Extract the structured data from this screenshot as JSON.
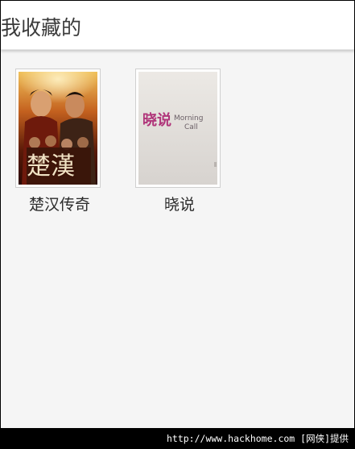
{
  "header": {
    "title": "我收藏的"
  },
  "favorites": [
    {
      "title": "楚汉传奇",
      "poster_text": "楚漢"
    },
    {
      "title": "晓说",
      "poster_brand": "晓说",
      "poster_en_1": "Morning",
      "poster_en_2": "Call"
    }
  ],
  "footer": {
    "watermark": "http://www.hackhome.com [网侠]提供"
  },
  "colors": {
    "background": "#f5f5f5",
    "header": "#ffffff",
    "text": "#2b2b2b",
    "brand_pink": "#b0357a"
  }
}
